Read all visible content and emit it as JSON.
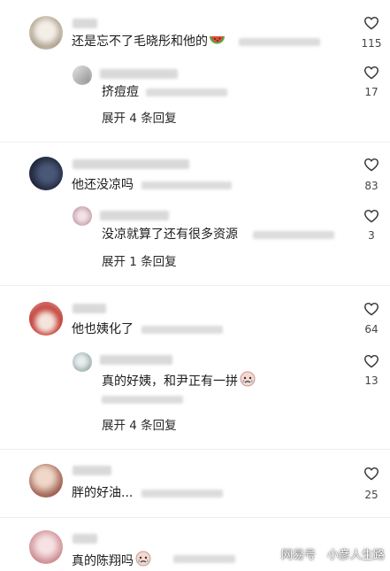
{
  "comments": [
    {
      "text": "还是忘不了毛晓彤和他的",
      "likes": "115",
      "reply": {
        "text": "挤痘痘",
        "likes": "17"
      },
      "expand": "展开 4 条回复"
    },
    {
      "text": "他还没凉吗",
      "likes": "83",
      "reply": {
        "text": "没凉就算了还有很多资源",
        "likes": "3"
      },
      "expand": "展开 1 条回复"
    },
    {
      "text": "他也姨化了",
      "likes": "64",
      "reply": {
        "text": "真的好姨，和尹正有一拼",
        "likes": "13"
      },
      "expand": "展开 4 条回复"
    },
    {
      "text": "胖的好油...",
      "likes": "25"
    },
    {
      "text": "真的陈翔吗"
    }
  ],
  "watermark": {
    "brand": "网易号",
    "author": "小彦人生路"
  },
  "icons": {
    "like": "heart-outline-icon",
    "watermelon": "watermelon-emoji-icon",
    "face": "crying-face-emoji-icon"
  },
  "colors": {
    "text": "#1b1b1b",
    "meta": "#dcdcdc",
    "icon": "#333333"
  }
}
